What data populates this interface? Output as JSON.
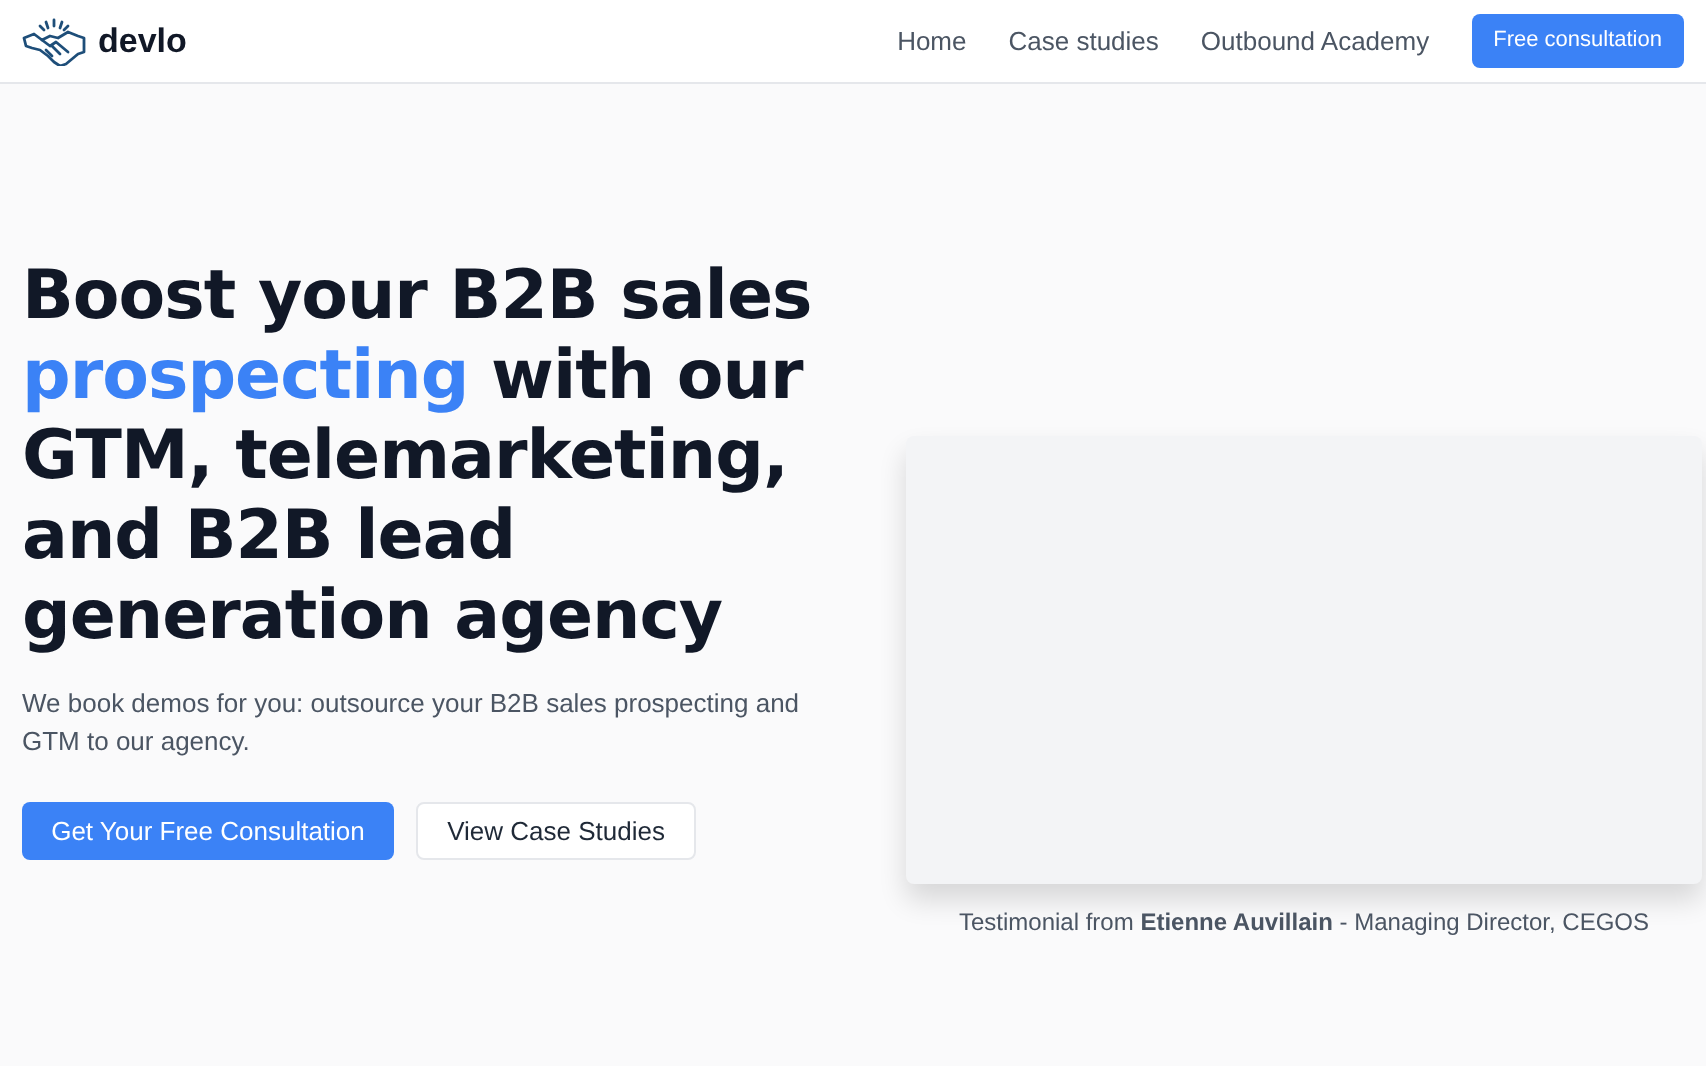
{
  "brand": {
    "name": "devlo"
  },
  "nav": {
    "links": [
      {
        "label": "Home"
      },
      {
        "label": "Case studies"
      },
      {
        "label": "Outbound Academy"
      }
    ],
    "cta": "Free consultation"
  },
  "hero": {
    "headline": [
      {
        "text": "Boost your B2B sales ",
        "highlight": false
      },
      {
        "text": "prospecting",
        "highlight": true
      },
      {
        "text": " with our GTM, telemarketing, and B2B lead generation agency",
        "highlight": false
      }
    ],
    "subtitle": "We book demos for you: outsource your B2B sales prospecting and GTM to our agency.",
    "primary_button": "Get Your Free Consultation",
    "secondary_button": "View Case Studies"
  },
  "testimonial": {
    "caption": "Testimonial from **Etienne Auvillain** - Managing Director, CEGOS"
  }
}
